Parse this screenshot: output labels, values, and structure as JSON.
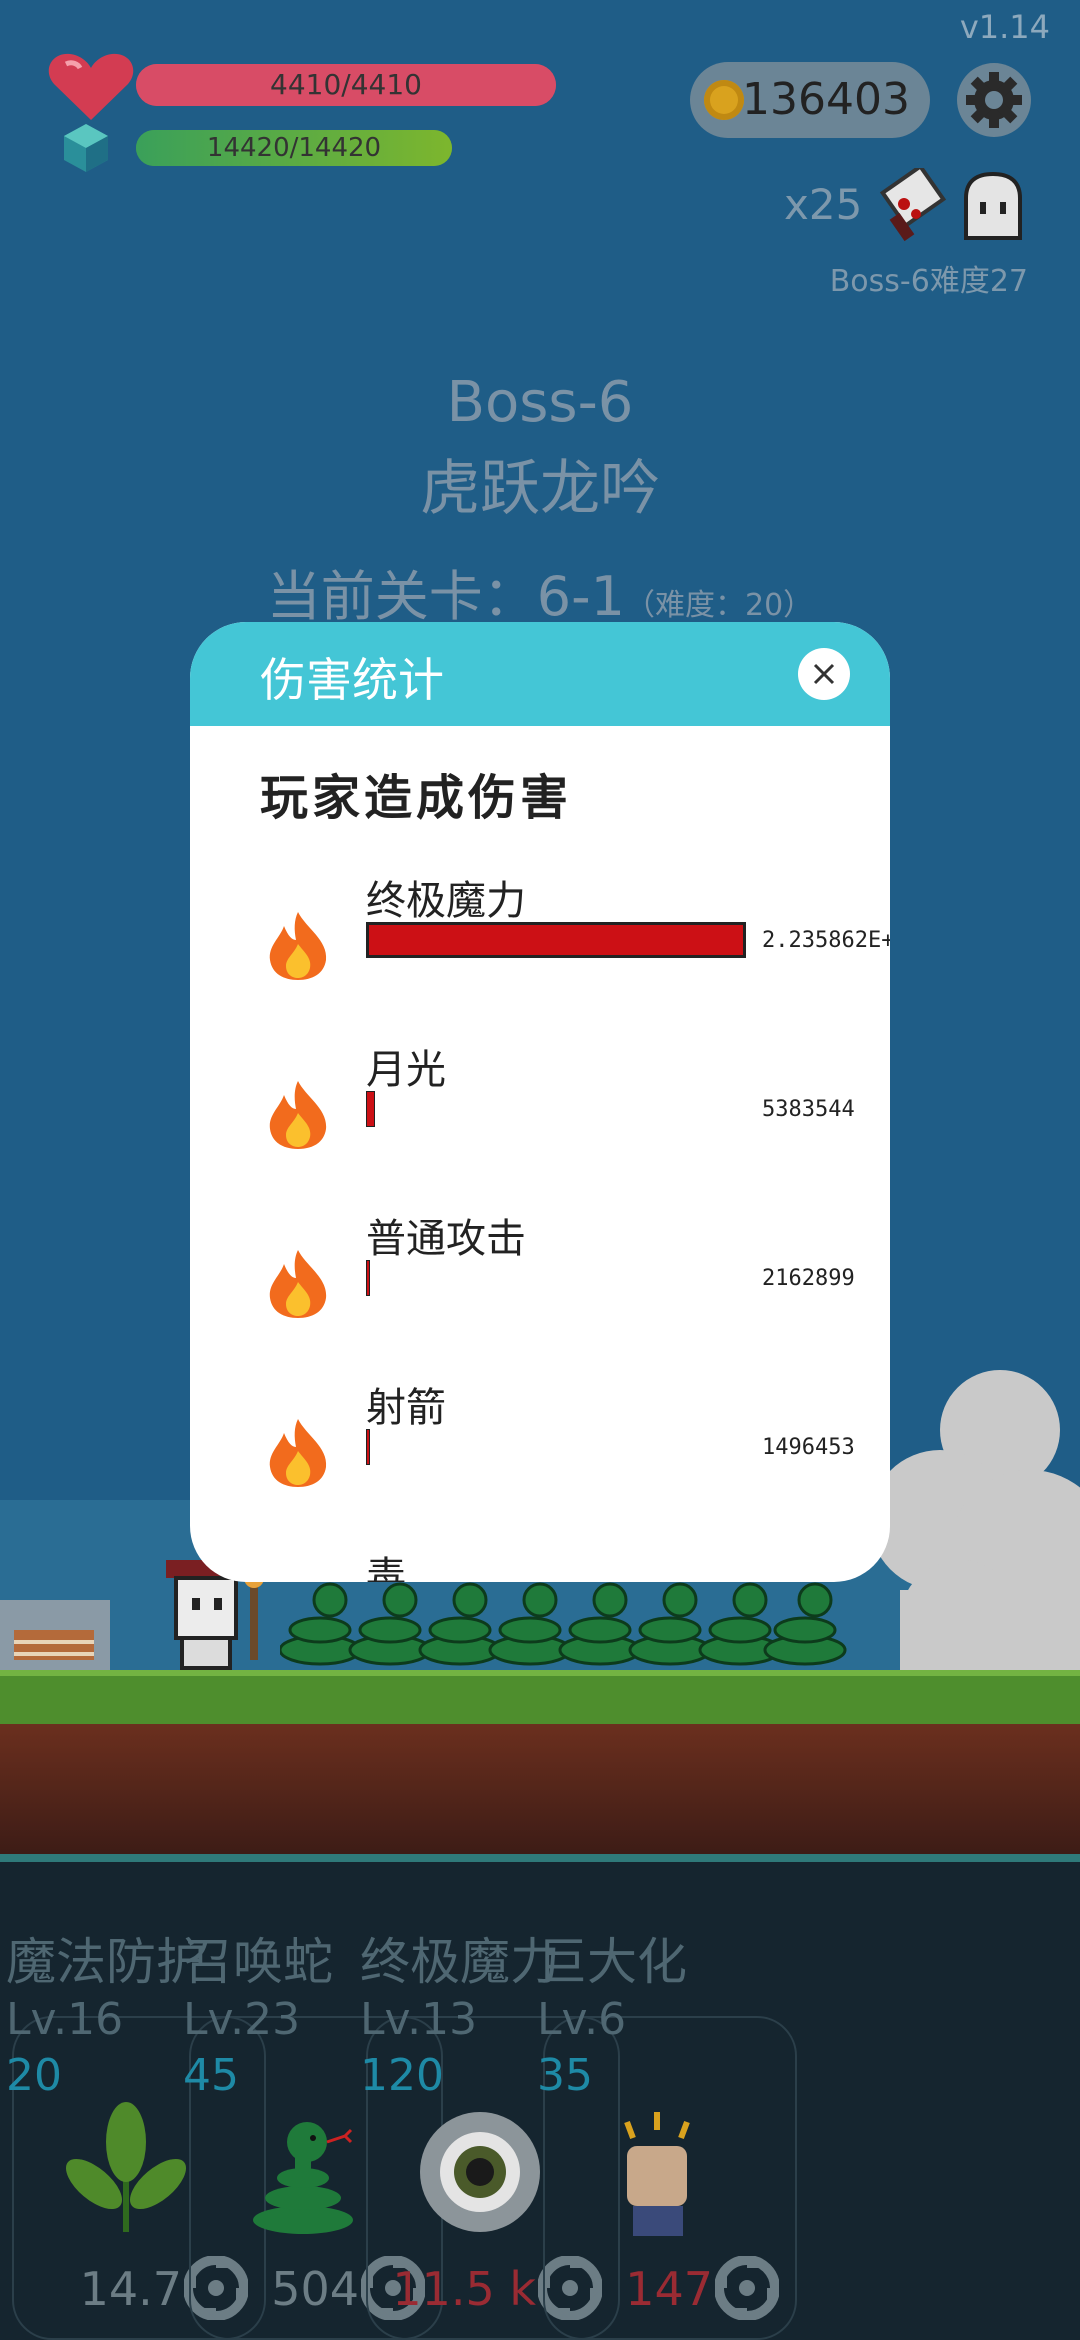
{
  "hud": {
    "version": "v1.14",
    "hp": {
      "text": "4410/4410",
      "fraction": 1.0
    },
    "mp": {
      "text": "14420/14420",
      "fraction": 1.0
    },
    "coins": "136403",
    "multiplier": "x25",
    "boss_difficulty": "Boss-6难度27",
    "colors": {
      "hp": "#d84c66",
      "mp": "#7db62d",
      "coin": "#d9a21e"
    }
  },
  "stage": {
    "boss_name": "Boss-6",
    "boss_subtitle": "虎跃龙吟",
    "level_label": "当前关卡：6-1",
    "level_difficulty": "（难度：20）"
  },
  "dialog": {
    "title": "伤害统计",
    "subtitle": "玩家造成伤害",
    "close_icon": "close-icon",
    "header_color": "#44c6d6",
    "rows": [
      {
        "name": "终极魔力",
        "value": "2.235862E+",
        "fraction": 1.0
      },
      {
        "name": "月光",
        "value": "5383544",
        "fraction": 0.024
      },
      {
        "name": "普通攻击",
        "value": "2162899",
        "fraction": 0.0097
      },
      {
        "name": "射箭",
        "value": "1496453",
        "fraction": 0.0067
      },
      {
        "name": "毒",
        "value": "",
        "fraction": 0
      }
    ]
  },
  "skills": [
    {
      "name": "魔法防护",
      "level": "Lv.16",
      "cost": "20",
      "value": "14.7",
      "icon": "leaf-icon",
      "value_color": "gray"
    },
    {
      "name": "召唤蛇",
      "level": "Lv.23",
      "cost": "45",
      "value": "504",
      "icon": "snake-icon",
      "value_color": "gray"
    },
    {
      "name": "终极魔力",
      "level": "Lv.13",
      "cost": "120",
      "value": "11.5 k",
      "icon": "eye-icon",
      "value_color": "red"
    },
    {
      "name": "巨大化",
      "level": "Lv.6",
      "cost": "35",
      "value": "147",
      "icon": "fist-icon",
      "value_color": "red"
    }
  ]
}
